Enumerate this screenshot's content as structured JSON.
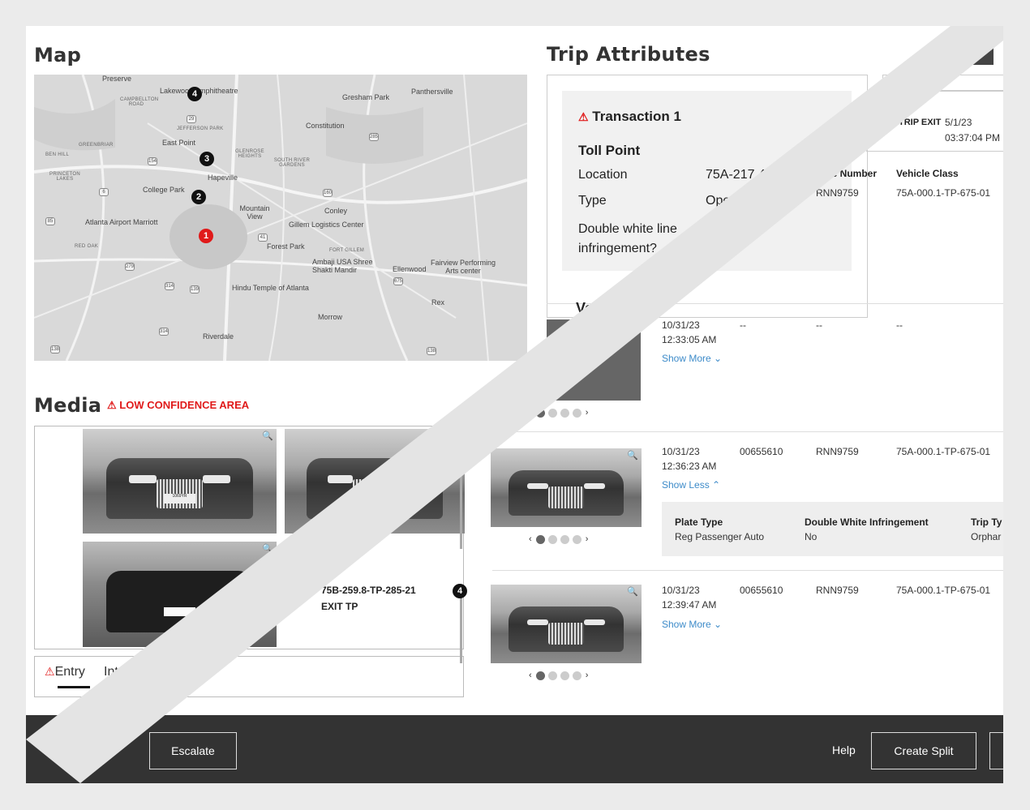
{
  "map": {
    "title": "Map",
    "labels": [
      "Preserve",
      "Lakewood Amphitheatre",
      "Gresham Park",
      "Panthersville",
      "CAMPBELLTON ROAD",
      "JEFFERSON PARK",
      "Constitution",
      "GREENBRIAR",
      "East Point",
      "GLENROSE HEIGHTS",
      "SOUTH RIVER GARDENS",
      "BEN HILL",
      "PRINCETON LAKES",
      "Hapeville",
      "College Park",
      "Mountain View",
      "Conley",
      "Atlanta Airport Marriott",
      "Gillem Logistics Center",
      "RED OAK",
      "Forest Park",
      "FORT GILLEM",
      "Ambaji USA Shree Shakti Mandir",
      "Ellenwood",
      "Fairview Performing Arts center",
      "Hindu Temple of Atlanta",
      "Rex",
      "Morrow",
      "Riverdale"
    ],
    "markers": [
      "4",
      "3",
      "2",
      "1"
    ]
  },
  "media": {
    "title": "Media",
    "warning": "LOW CONFIDENCE AREA",
    "plate_text": "1069YR",
    "tabs": [
      "Entry",
      "Intermedi"
    ],
    "point_code": "75B-259.8-TP-285-21",
    "point_type": "EXIT TP",
    "point_number": "4"
  },
  "trip": {
    "title": "Trip Attributes",
    "transaction": "Transaction 1",
    "toll_point": "Toll Point",
    "rows": [
      {
        "label": "Location",
        "value": "75A-217.4"
      },
      {
        "label": "Type",
        "value": "Open"
      },
      {
        "label": "Double white line infringement?",
        "value": "..."
      }
    ],
    "trip_exit_label": "TRIP EXIT",
    "trip_exit_date": "5/1/23",
    "trip_exit_time": "03:37:04 PM",
    "cut_time": "M",
    "headers": [
      "Plate Number",
      "Vehicle Class"
    ],
    "header_cut": "ate Number",
    "first_row": {
      "plate": "RNN9759",
      "class": "75A-000.1-TP-675-01"
    },
    "vehicle_heading": "Vehi",
    "image_text": "ge",
    "txns": [
      {
        "date": "10/31/23",
        "time": "12:33:05 AM",
        "id": "--",
        "plate": "--",
        "class": "--",
        "toggle": "Show More"
      },
      {
        "date": "10/31/23",
        "time": "12:36:23 AM",
        "id": "00655610",
        "plate": "RNN9759",
        "class": "75A-000.1-TP-675-01",
        "toggle": "Show Less"
      },
      {
        "date": "10/31/23",
        "time": "12:39:47 AM",
        "id": "00655610",
        "plate": "RNN9759",
        "class": "75A-000.1-TP-675-01",
        "toggle": "Show More"
      }
    ],
    "detail": {
      "h1": "Plate Type",
      "v1": "Reg Passenger Auto",
      "h2": "Double White Infringement",
      "v2": "No",
      "h3": "Trip Ty",
      "v3": "Orphar"
    }
  },
  "footer": {
    "escalate": "Escalate",
    "help": "Help",
    "create_split": "Create Split"
  },
  "colors": {
    "accent_red": "#e01a1a",
    "link_blue": "#3d8bc9",
    "footer_bg": "#333333"
  }
}
